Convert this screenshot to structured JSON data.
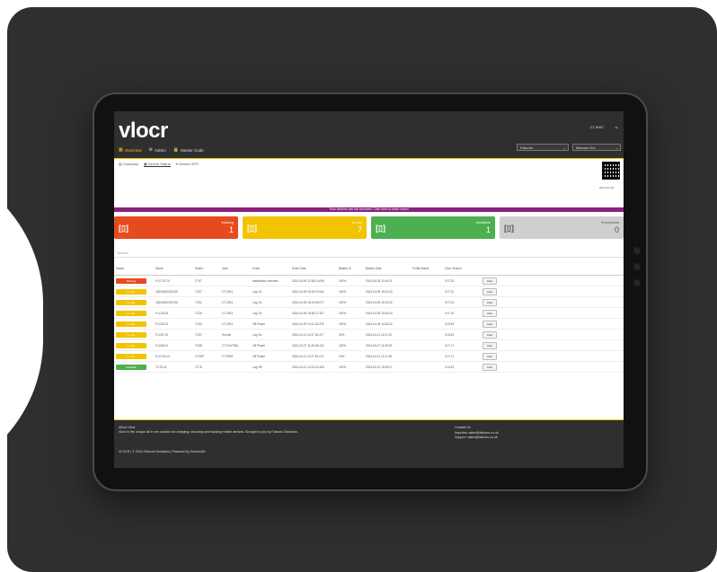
{
  "app": {
    "logo": "vlocr"
  },
  "header": {
    "user_name": "CT-6067",
    "nav": [
      "Overview",
      "Admin",
      "Master Code"
    ],
    "company_select": "Falcons",
    "person_select": "Marcum Xul"
  },
  "subnav": [
    "Company",
    "Device Status",
    "Device GPS"
  ],
  "banner": "Your devices are not serviced. Click here to learn more!",
  "cards": [
    {
      "label": "Missing",
      "value": "1",
      "color": "#e64b1e"
    },
    {
      "label": "In Use",
      "value": "7",
      "color": "#f2c300"
    },
    {
      "label": "Available",
      "value": "1",
      "color": "#4caf50"
    },
    {
      "label": "Exceptions",
      "value": "0",
      "color": "#cfcfcf"
    }
  ],
  "search_label": "Search",
  "table": {
    "headers": [
      "Status",
      "Name",
      "Model",
      "User",
      "Event",
      "Event Date",
      "Battery %",
      "Battery Date",
      "Profile Name",
      "Vlocr Version",
      ""
    ],
    "rows": [
      [
        "Missing",
        "FLCT47-01",
        "CT47",
        "",
        "dashboard.overview",
        "2024-04-09 12:36:14.094",
        "100%",
        "2024-04-09 12:44:21",
        "",
        "V17.25",
        "View"
      ],
      [
        "In Use",
        "18240522301155",
        "TC57",
        "CT-2901",
        "Log On",
        "2024-04-09 15:19:10.644",
        "100%",
        "2024-04-09 15:21:00",
        "",
        "V17.22",
        "View"
      ],
      [
        "In Use",
        "18240522301796",
        "TC51",
        "CT-2901",
        "Log On",
        "2024-04-09 15:19:56.077",
        "100%",
        "2024-04-09 15:22:52",
        "",
        "V17.23",
        "View"
      ],
      [
        "In Use",
        "FLC26-00",
        "TC26",
        "CT-2901",
        "Log On",
        "2024-04-09 15:46:17.207",
        "100%",
        "2024-04-09 15:44:03",
        "",
        "V17.19",
        "View"
      ],
      [
        "In Use",
        "FLC53-01",
        "TC53",
        "CT-2901",
        "Off Power",
        "2024-04-09 14:11:30.476",
        "100%",
        "2024-04-09 14:15:42",
        "",
        "V13.53",
        "View"
      ],
      [
        "In Use",
        "FLC57-02",
        "TC57",
        "Human",
        "Log On",
        "2024-04-11 11:37:18.477",
        "20%",
        "2024-04-11 11:37:22",
        "",
        "V13.53",
        "View"
      ],
      [
        "In Use",
        "FLC58-01",
        "TC58",
        "CT-ChriTR81",
        "Off Power",
        "2024-03-27 11:33:06.424",
        "100%",
        "2024-03-27 11:28:53",
        "",
        "V17.17",
        "View"
      ],
      [
        "In Use",
        "FLCT40-01",
        "CT40P",
        "CT-9993",
        "Off Power",
        "2024-04-11 11:27:53.174",
        "19%",
        "2024-04-11 11:17:45",
        "",
        "V17.21",
        "View"
      ],
      [
        "Available",
        "TC78-01",
        "TC78",
        "",
        "Log Off",
        "2024-03-21 14:31:21.826",
        "100%",
        "2024-03-21 15:39:37",
        "",
        "V13.53",
        "View"
      ]
    ],
    "status_colors": {
      "Missing": "#e64b1e",
      "In Use": "#f2c300",
      "Available": "#4caf50"
    }
  },
  "footer": {
    "about_title": "About Vlocr",
    "about_text": "Vlocr is the unique all in one solution for charging, securing and tracking mobile devices. Brought to you by Falcons Solutions.",
    "copyright": "VLOCR | © 2024 Falcons Solutions | Powered By ConnectID",
    "contact_title": "Contact Us",
    "inquiries": "Inquiries: sales@falcons.co.uk",
    "support": "Support: sales@falcons.co.uk"
  },
  "device_label": "DEVICE QR"
}
